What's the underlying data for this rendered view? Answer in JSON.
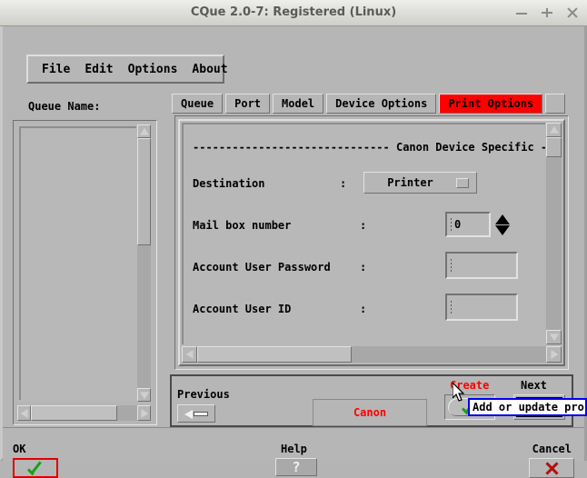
{
  "window": {
    "title": "CQue 2.0-7: Registered (Linux)",
    "controls": [
      {
        "name": "minimize",
        "glyph": "−"
      },
      {
        "name": "maximize",
        "glyph": "+"
      },
      {
        "name": "close",
        "glyph": "×"
      }
    ]
  },
  "menubar": {
    "items": [
      "File",
      "Edit",
      "Options",
      "About"
    ]
  },
  "sidebar": {
    "label": "Queue Name:",
    "items": []
  },
  "tabs": [
    {
      "label": "Queue",
      "active": false
    },
    {
      "label": "Port",
      "active": false
    },
    {
      "label": "Model",
      "active": false
    },
    {
      "label": "Device Options",
      "active": false
    },
    {
      "label": "Print Options",
      "active": true
    }
  ],
  "tab_accent_color": "#ff0000",
  "form": {
    "header": "------------------------------ Canon Device Specific ----",
    "rows": [
      {
        "label": "Destination",
        "colon": ":",
        "type": "combo",
        "value": "Printer"
      },
      {
        "label": "Mail box number",
        "colon": ":",
        "type": "spinner",
        "value": "0"
      },
      {
        "label": "Account User Password",
        "colon": ":",
        "type": "text",
        "value": ""
      },
      {
        "label": "Account User ID",
        "colon": ":",
        "type": "text",
        "value": ""
      }
    ]
  },
  "navbar": {
    "previous_label": "Previous",
    "model_name": "Canon",
    "create_label": "Create",
    "next_label": "Next"
  },
  "bottombar": {
    "ok_label": "OK",
    "help_label": "Help",
    "help_glyph": "?",
    "cancel_label": "Cancel"
  },
  "tooltip": {
    "text": "Add or update prof"
  },
  "colors": {
    "face": "#b6b6b6",
    "accent_red": "#ff0000",
    "tooltip_border": "#0000ee",
    "check_green": "#16a016",
    "cancel_red": "#b01010"
  }
}
